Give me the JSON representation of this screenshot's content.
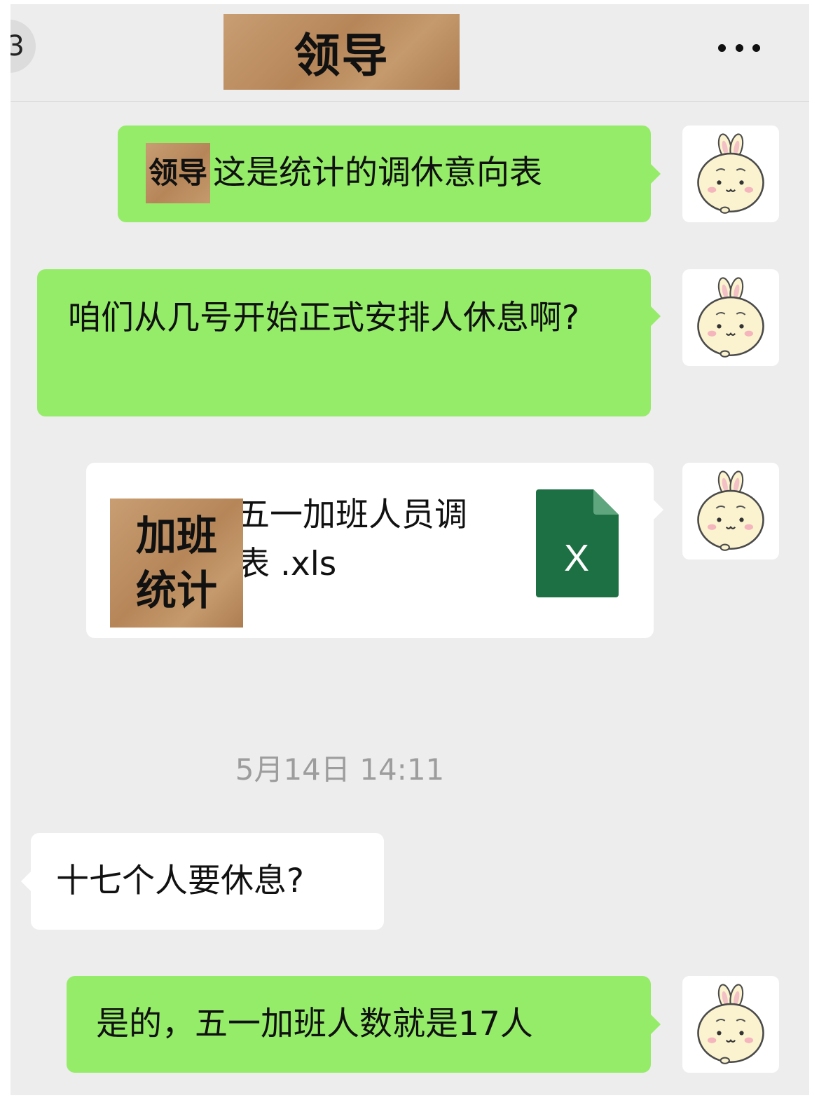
{
  "header": {
    "back_label": "3",
    "title": "领导"
  },
  "messages": [
    {
      "id": 1,
      "side": "right",
      "type": "text",
      "name_tag": "领导",
      "text": "这是统计的调休意向表"
    },
    {
      "id": 2,
      "side": "right",
      "type": "text",
      "text": "咱们从几号开始正式安排人休息啊?"
    },
    {
      "id": 3,
      "side": "right",
      "type": "file",
      "file_name_visible": "五一加班人员调休表 .xls",
      "file_name_line1": "五一加班人员调",
      "file_name_line2": "表 .xls",
      "cover_label": "加班\n统计",
      "file_icon": "excel-file-icon",
      "file_icon_letter": "X"
    },
    {
      "id": 4,
      "side": "left",
      "type": "text",
      "text": "十七个人要休息?"
    },
    {
      "id": 5,
      "side": "right",
      "type": "text",
      "text": "是的，五一加班人数就是17人"
    }
  ],
  "timestamp": "5月14日 14:11",
  "colors": {
    "chat_background": "#ededed",
    "sent_bubble": "#95ec69",
    "received_bubble": "#ffffff",
    "excel_green": "#1d7044",
    "timestamp_text": "#9d9d9d"
  },
  "avatar_icon": "bunny-avatar-icon"
}
